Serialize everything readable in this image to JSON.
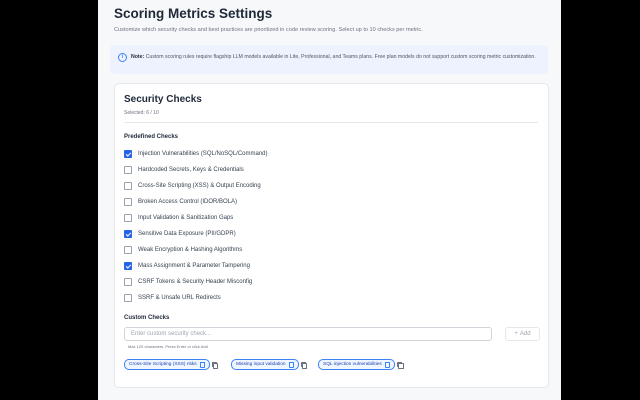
{
  "page": {
    "title": "Scoring Metrics Settings",
    "subtitle": "Customize which security checks and best practices are prioritized in code review scoring. Select up to 10 checks per metric."
  },
  "note": {
    "label": "Note:",
    "text": "Custom scoring rules require flagship LLM models available in Lite, Professional, and Teams plans. Free plan models do not support custom scoring metric customization."
  },
  "card": {
    "title": "Security Checks",
    "selected": "Selected: 6 / 10",
    "predefined_label": "Predefined Checks",
    "checks": [
      {
        "label": "Injection Vulnerabilities (SQL/NoSQL/Command)",
        "checked": true
      },
      {
        "label": "Hardcoded Secrets, Keys & Credentials",
        "checked": false
      },
      {
        "label": "Cross-Site Scripting (XSS) & Output Encoding",
        "checked": false
      },
      {
        "label": "Broken Access Control (IDOR/BOLA)",
        "checked": false
      },
      {
        "label": "Input Validation & Sanitization Gaps",
        "checked": false
      },
      {
        "label": "Sensitive Data Exposure (PII/GDPR)",
        "checked": true
      },
      {
        "label": "Weak Encryption & Hashing Algorithms",
        "checked": false
      },
      {
        "label": "Mass Assignment & Parameter Tampering",
        "checked": true
      },
      {
        "label": "CSRF Tokens & Security Header Misconfig",
        "checked": false
      },
      {
        "label": "SSRF & Unsafe URL Redirects",
        "checked": false
      }
    ],
    "custom_label": "Custom Checks",
    "custom_placeholder": "Enter custom security check...",
    "add_label": "Add",
    "hint": "Max 120 characters. Press Enter or click Add",
    "chips": [
      "Cross-Site Scripting (XSS) risks",
      "Missing input validation",
      "SQL injection vulnerabilities"
    ]
  },
  "colors": {
    "accent": "#2563eb",
    "note_bg": "#eef2ff",
    "chip_bg": "#eff6ff"
  }
}
